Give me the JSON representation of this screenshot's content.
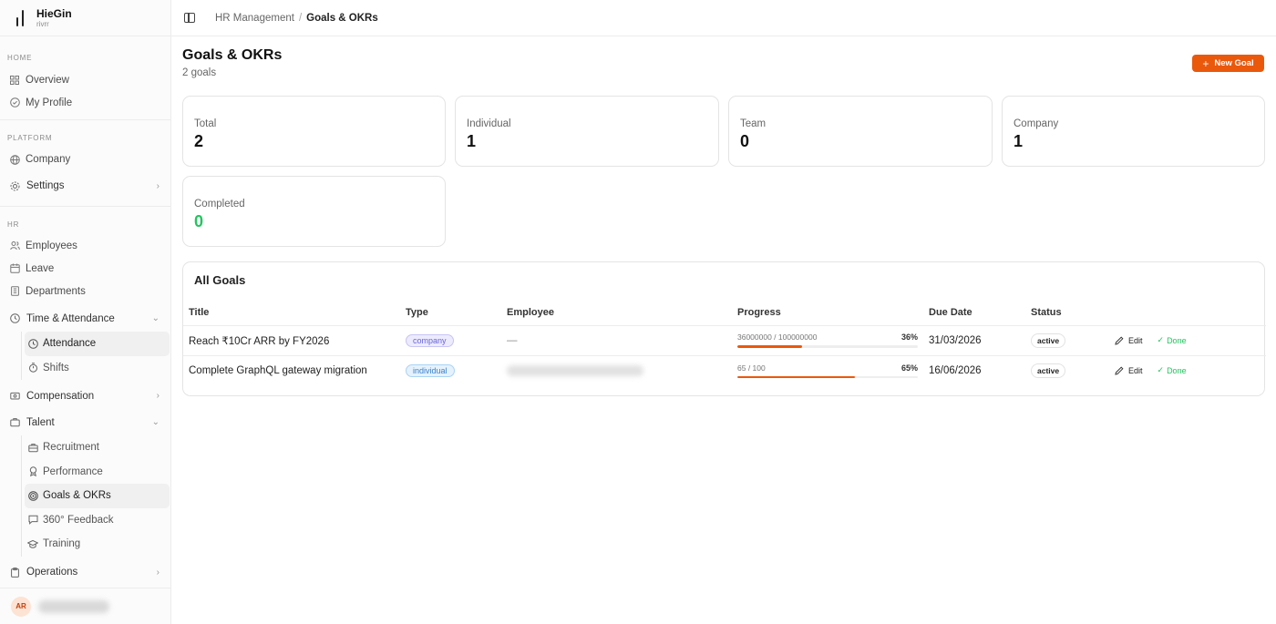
{
  "brand": {
    "name": "HieGin",
    "sub": "rivrr"
  },
  "sidebar": {
    "home_label": "HOME",
    "home_items": [
      {
        "label": "Overview",
        "icon": "grid-icon"
      },
      {
        "label": "My Profile",
        "icon": "user-circle-icon"
      }
    ],
    "platform_label": "PLATFORM",
    "platform_items": [
      {
        "label": "Company",
        "icon": "globe-icon"
      },
      {
        "label": "Settings",
        "icon": "gear-icon"
      }
    ],
    "hr_label": "HR",
    "hr_items": [
      {
        "label": "Employees",
        "icon": "users-icon"
      },
      {
        "label": "Leave",
        "icon": "calendar-icon"
      },
      {
        "label": "Departments",
        "icon": "building-icon"
      }
    ],
    "time_group": {
      "label": "Time & Attendance",
      "items": [
        "Attendance",
        "Shifts"
      ]
    },
    "compensation_label": "Compensation",
    "talent_group": {
      "label": "Talent",
      "items": [
        "Recruitment",
        "Performance",
        "Goals & OKRs",
        "360° Feedback",
        "Training"
      ]
    },
    "operations_label": "Operations",
    "user_initials": "AR"
  },
  "breadcrumb": {
    "parent": "HR Management",
    "separator": "/",
    "current": "Goals & OKRs"
  },
  "page": {
    "title": "Goals & OKRs",
    "subtitle": "2 goals",
    "new_button": "New Goal",
    "new_button_icon": "+"
  },
  "stats": [
    {
      "label": "Total",
      "value": "2"
    },
    {
      "label": "Individual",
      "value": "1"
    },
    {
      "label": "Team",
      "value": "0"
    },
    {
      "label": "Company",
      "value": "1"
    },
    {
      "label": "Completed",
      "value": "0"
    }
  ],
  "goals": {
    "title": "All Goals",
    "columns": [
      "Title",
      "Type",
      "Employee",
      "Progress",
      "Due Date",
      "Status"
    ],
    "rows": [
      {
        "title": "Reach ₹10Cr ARR by FY2026",
        "type": "company",
        "employee": "—",
        "progress_text": "36000000 / 100000000",
        "progress_pct": "36%",
        "progress_fraction": 0.36,
        "due": "31/03/2026",
        "status": "active",
        "edit": "Edit",
        "done": "Done"
      },
      {
        "title": "Complete GraphQL gateway migration",
        "type": "individual",
        "employee": "",
        "progress_text": "65 / 100",
        "progress_pct": "65%",
        "progress_fraction": 0.65,
        "due": "16/06/2026",
        "status": "active",
        "edit": "Edit",
        "done": "Done"
      }
    ]
  },
  "colors": {
    "accent": "#ea580c",
    "success": "#22c55e",
    "company_badge": "#6b64d8",
    "individual_badge": "#3b82c9"
  }
}
